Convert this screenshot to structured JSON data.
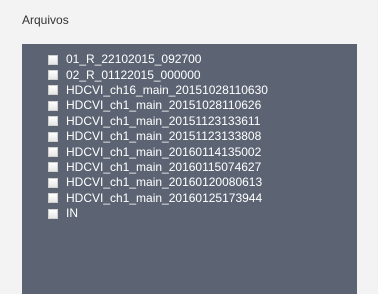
{
  "panel": {
    "title": "Arquivos"
  },
  "files": [
    {
      "label": "01_R_22102015_092700",
      "checked": false
    },
    {
      "label": "02_R_01122015_000000",
      "checked": false
    },
    {
      "label": "HDCVI_ch16_main_20151028110630",
      "checked": false
    },
    {
      "label": "HDCVI_ch1_main_20151028110626",
      "checked": false
    },
    {
      "label": "HDCVI_ch1_main_20151123133611",
      "checked": false
    },
    {
      "label": "HDCVI_ch1_main_20151123133808",
      "checked": false
    },
    {
      "label": "HDCVI_ch1_main_20160114135002",
      "checked": false
    },
    {
      "label": "HDCVI_ch1_main_20160115074627",
      "checked": false
    },
    {
      "label": "HDCVI_ch1_main_20160120080613",
      "checked": false
    },
    {
      "label": "HDCVI_ch1_main_20160125173944",
      "checked": false
    },
    {
      "label": "IN",
      "checked": false
    }
  ],
  "colors": {
    "list_background": "#5c6474",
    "page_background": "#f3f3f3",
    "label_text": "#ffffff"
  }
}
